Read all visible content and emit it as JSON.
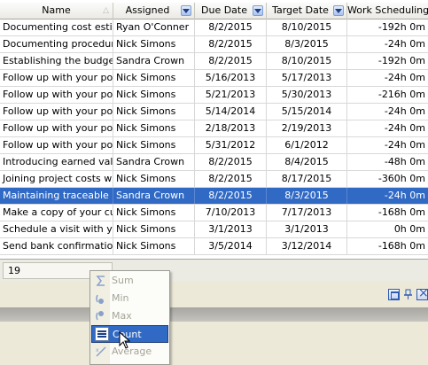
{
  "columns": {
    "name": "Name",
    "assigned": "Assigned",
    "due_date": "Due Date",
    "target_date": "Target Date",
    "work_scheduling": "Work Scheduling"
  },
  "rows": [
    {
      "name": "Documenting cost estimat",
      "assigned": "Ryan O'Conner",
      "due": "8/2/2015",
      "target": "8/10/2015",
      "ws": "-192h 0m"
    },
    {
      "name": "Documenting procedures",
      "assigned": "Nick Simons",
      "due": "8/2/2015",
      "target": "8/3/2015",
      "ws": "-24h 0m"
    },
    {
      "name": "Establishing the budget fo",
      "assigned": "Sandra Crown",
      "due": "8/2/2015",
      "target": "8/10/2015",
      "ws": "-192h 0m"
    },
    {
      "name": "Follow up with your poter",
      "assigned": "Nick Simons",
      "due": "5/16/2013",
      "target": "5/17/2013",
      "ws": "-24h 0m"
    },
    {
      "name": "Follow up with your poter",
      "assigned": "Nick Simons",
      "due": "5/21/2013",
      "target": "5/30/2013",
      "ws": "-216h 0m"
    },
    {
      "name": "Follow up with your poter",
      "assigned": "Nick Simons",
      "due": "5/14/2014",
      "target": "5/15/2014",
      "ws": "-24h 0m"
    },
    {
      "name": "Follow up with your poter",
      "assigned": "Nick Simons",
      "due": "2/18/2013",
      "target": "2/19/2013",
      "ws": "-24h 0m"
    },
    {
      "name": "Follow up with your poter",
      "assigned": "Nick Simons",
      "due": "5/31/2012",
      "target": "6/1/2012",
      "ws": "-24h 0m"
    },
    {
      "name": "Introducing earned value",
      "assigned": "Sandra Crown",
      "due": "8/2/2015",
      "target": "8/4/2015",
      "ws": "-48h 0m"
    },
    {
      "name": "Joining project costs with",
      "assigned": "Nick Simons",
      "due": "8/2/2015",
      "target": "8/17/2015",
      "ws": "-360h 0m"
    },
    {
      "name": "Maintaining traceable plar",
      "assigned": "Sandra Crown",
      "due": "8/2/2015",
      "target": "8/3/2015",
      "ws": "-24h 0m"
    },
    {
      "name": "Make a copy of your custi",
      "assigned": "Nick Simons",
      "due": "7/10/2013",
      "target": "7/17/2013",
      "ws": "-168h 0m"
    },
    {
      "name": "Schedule a visit with your",
      "assigned": "Nick Simons",
      "due": "3/1/2013",
      "target": "3/1/2013",
      "ws": "0h 0m"
    },
    {
      "name": "Send bank confirmation",
      "assigned": "Nick Simons",
      "due": "3/5/2014",
      "target": "3/12/2014",
      "ws": "-168h 0m"
    }
  ],
  "selected_row_index": 10,
  "footer": {
    "count_value": "19"
  },
  "context_menu": {
    "items": [
      {
        "label": "Sum",
        "icon": "sum-icon",
        "enabled": false
      },
      {
        "label": "Min",
        "icon": "min-icon",
        "enabled": false
      },
      {
        "label": "Max",
        "icon": "max-icon",
        "enabled": false
      },
      {
        "label": "Count",
        "icon": "count-icon",
        "enabled": true,
        "highlighted": true
      },
      {
        "label": "Average",
        "icon": "average-icon",
        "enabled": false
      }
    ]
  },
  "colors": {
    "selection": "#316ac5",
    "header_bg": "#ebeae4",
    "filter_button": "#aac2ee"
  }
}
